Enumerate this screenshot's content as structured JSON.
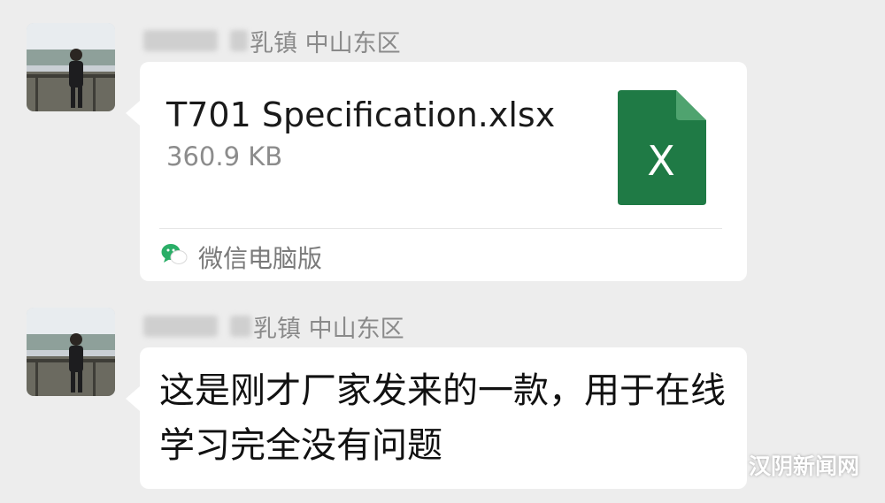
{
  "messages": [
    {
      "sender": {
        "location": "乳镇 中山东区"
      },
      "file_card": {
        "file_name": "T701 Specification.xlsx",
        "file_size": "360.9 KB",
        "icon_letter": "X",
        "source_app": "微信电脑版"
      }
    },
    {
      "sender": {
        "location": "乳镇 中山东区"
      },
      "text": "这是刚才厂家发来的一款，用于在线学习完全没有问题"
    }
  ],
  "watermark": {
    "text": "汉阴新闻网"
  },
  "colors": {
    "background": "#ededed",
    "bubble": "#ffffff",
    "excel_green": "#1f7a45",
    "wechat_green": "#2aae67"
  },
  "icons": [
    "excel-file-icon",
    "wechat-icon",
    "wechat-watermark-icon"
  ]
}
